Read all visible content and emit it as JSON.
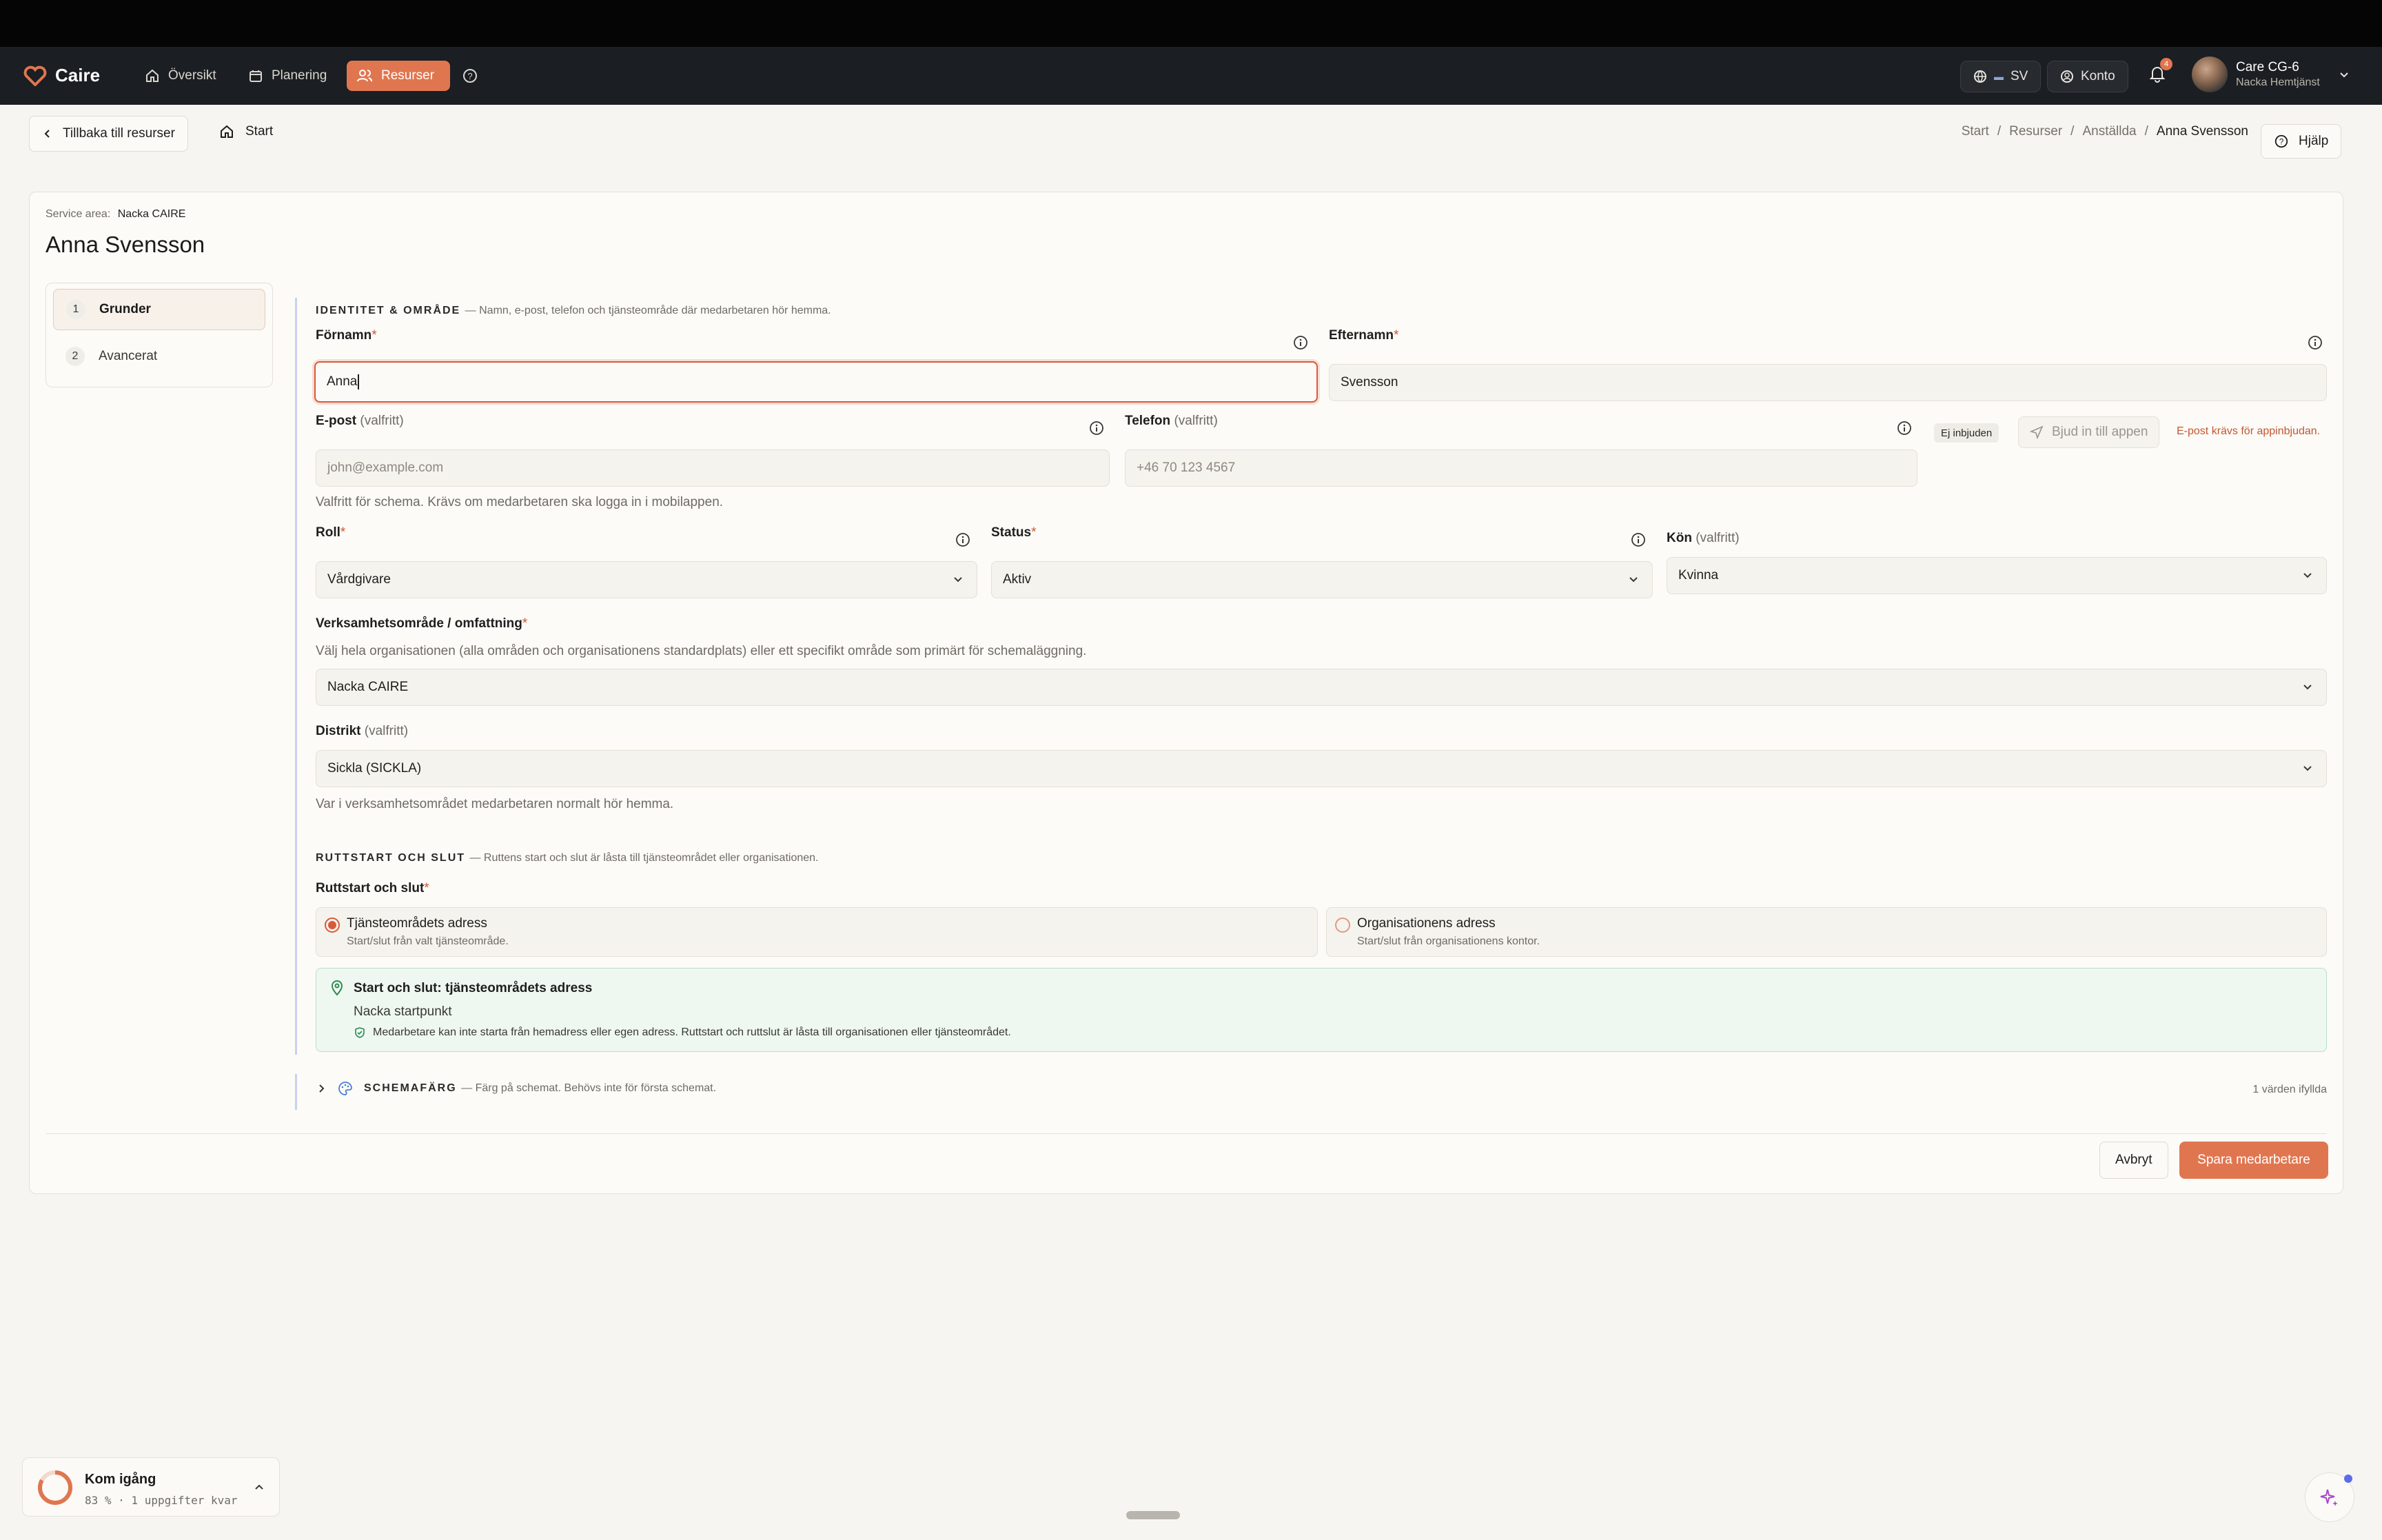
{
  "brand": {
    "name": "Caire",
    "accent": "#e07650"
  },
  "nav": {
    "items": [
      {
        "label": "Översikt",
        "icon": "home-icon"
      },
      {
        "label": "Planering",
        "icon": "calendar-icon"
      },
      {
        "label": "Resurser",
        "icon": "users-icon",
        "active": true
      }
    ],
    "language": "SV",
    "account": "Konto",
    "notifications_count": "4",
    "user": {
      "name": "Care CG-6",
      "org": "Nacka Hemtjänst"
    }
  },
  "subbar": {
    "back": "Tillbaka till resurser",
    "home": "Start",
    "breadcrumbs": [
      "Start",
      "Resurser",
      "Anställda",
      "Anna Svensson"
    ],
    "help": "Hjälp"
  },
  "page": {
    "service_area_label": "Service area:",
    "service_area_value": "Nacka CAIRE",
    "title": "Anna Svensson"
  },
  "steps": [
    {
      "num": "1",
      "label": "Grunder",
      "active": true
    },
    {
      "num": "2",
      "label": "Avancerat",
      "active": false
    }
  ],
  "identity": {
    "title": "IDENTITET & OMRÅDE",
    "desc": "— Namn, e-post, telefon och tjänsteområde där medarbetaren hör hemma.",
    "first_name_label": "Förnamn",
    "first_name_value": "Anna",
    "last_name_label": "Efternamn",
    "last_name_value": "Svensson",
    "email_label": "E-post",
    "email_opt": "(valfritt)",
    "email_placeholder": "john@example.com",
    "email_help": "Valfritt för schema. Krävs om medarbetaren ska logga in i mobilappen.",
    "phone_label": "Telefon",
    "phone_opt": "(valfritt)",
    "phone_placeholder": "+46 70 123 4567",
    "invite_badge": "Ej inbjuden",
    "invite_button": "Bjud in till appen",
    "invite_warning": "E-post krävs för appinbjudan.",
    "role_label": "Roll",
    "role_value": "Vårdgivare",
    "status_label": "Status",
    "status_value": "Aktiv",
    "gender_label": "Kön",
    "gender_opt": "(valfritt)",
    "gender_value": "Kvinna",
    "area_label": "Verksamhetsområde / omfattning",
    "area_help": "Välj hela organisationen (alla områden och organisationens standardplats) eller ett specifikt område som primärt för schemaläggning.",
    "area_value": "Nacka CAIRE",
    "district_label": "Distrikt",
    "district_opt": "(valfritt)",
    "district_value": "Sickla (SICKLA)",
    "district_help": "Var i verksamhetsområdet medarbetaren normalt hör hemma."
  },
  "route": {
    "title": "RUTTSTART OCH SLUT",
    "desc": "— Ruttens start och slut är låsta till tjänsteområdet eller organisationen.",
    "label": "Ruttstart och slut",
    "option1_title": "Tjänsteområdets adress",
    "option1_sub": "Start/slut från valt tjänsteområde.",
    "option2_title": "Organisationens adress",
    "option2_sub": "Start/slut från organisationens kontor.",
    "info_title": "Start och slut: tjänsteområdets adress",
    "info_place": "Nacka startpunkt",
    "info_note": "Medarbetare kan inte starta från hemadress eller egen adress. Ruttstart och ruttslut är låsta till organisationen eller tjänsteområdet."
  },
  "color": {
    "title": "SCHEMAFÄRG",
    "desc": "— Färg på schemat. Behövs inte för första schemat.",
    "count": "1 värden ifyllda"
  },
  "footer": {
    "cancel": "Avbryt",
    "save": "Spara medarbetare"
  },
  "onboarding": {
    "title": "Kom igång",
    "progress_text": "83 % · 1 uppgifter kvar",
    "progress": 0.83
  }
}
